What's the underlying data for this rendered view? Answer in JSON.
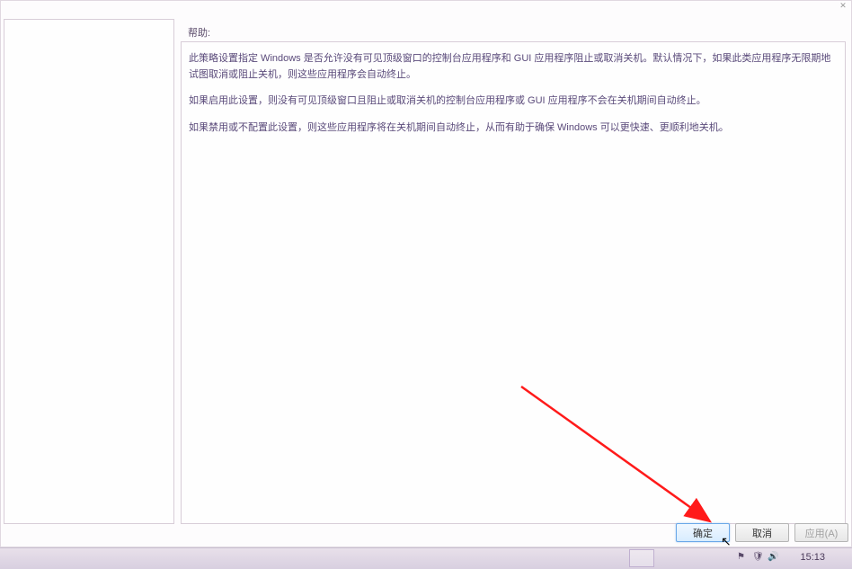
{
  "window": {
    "help_label": "帮助:",
    "paragraphs": {
      "p1": "此策略设置指定 Windows 是否允许没有可见顶级窗口的控制台应用程序和 GUI 应用程序阻止或取消关机。默认情况下，如果此类应用程序无限期地试图取消或阻止关机，则这些应用程序会自动终止。",
      "p2": "如果启用此设置，则没有可见顶级窗口且阻止或取消关机的控制台应用程序或 GUI 应用程序不会在关机期间自动终止。",
      "p3": "如果禁用或不配置此设置，则这些应用程序将在关机期间自动终止，从而有助于确保 Windows 可以更快速、更顺利地关机。"
    }
  },
  "buttons": {
    "ok": "确定",
    "cancel": "取消",
    "apply": "应用(A)"
  },
  "taskbar": {
    "time": "15:13"
  }
}
